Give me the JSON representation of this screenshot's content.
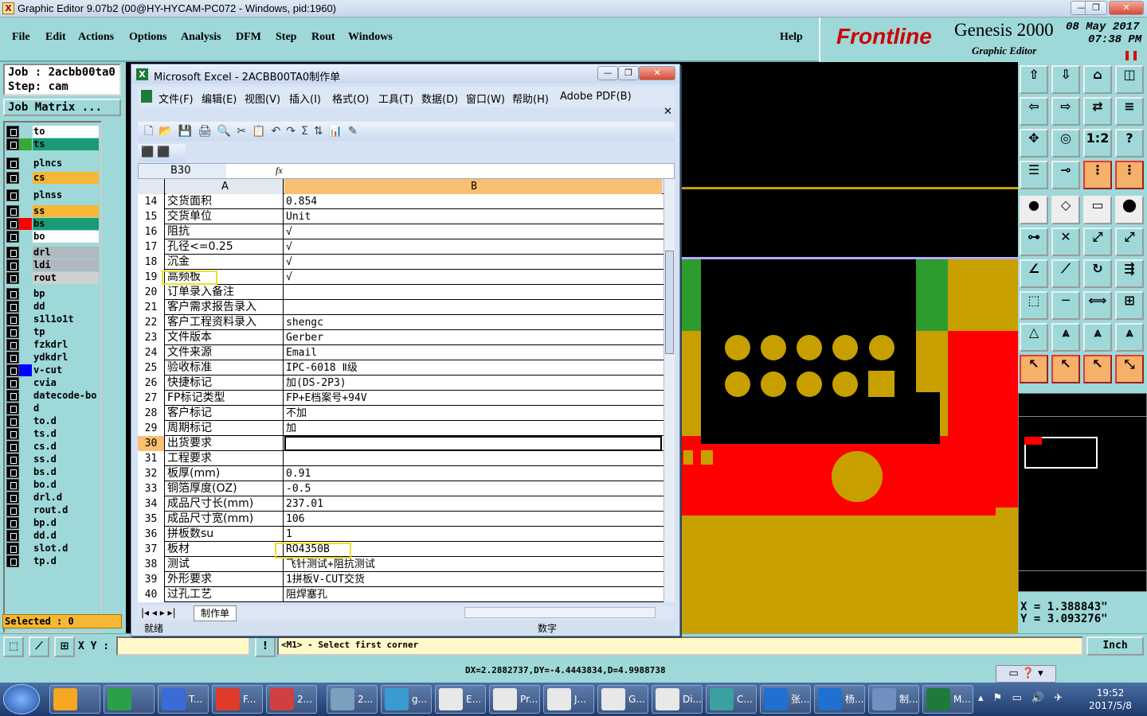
{
  "window": {
    "title": "Graphic Editor 9.07b2 (00@HY-HYCAM-PC072 - Windows, pid:1960)"
  },
  "menu": [
    "File",
    "Edit",
    "Actions",
    "Options",
    "Analysis",
    "DFM",
    "Step",
    "Rout",
    "Windows"
  ],
  "help": "Help",
  "brand": {
    "logo": "Frontline",
    "product": "Genesis 2000",
    "subtitle": "Graphic Editor",
    "date": "08 May 2017",
    "time": "07:38 PM"
  },
  "job": {
    "job_label": "Job : 2acbb00ta0",
    "step_label": "Step: cam",
    "matrix_button": "Job Matrix ..."
  },
  "layers": [
    {
      "name": "to",
      "color": "#ffffff",
      "swatch": ""
    },
    {
      "name": "ts",
      "color": "#1a9b76",
      "swatch": "#38a838"
    },
    {
      "name": "plncs",
      "color": "#9ed8d8",
      "swatch": ""
    },
    {
      "name": "cs",
      "color": "#f5b735",
      "swatch": ""
    },
    {
      "name": "plnss",
      "color": "#9ed8d8",
      "swatch": ""
    },
    {
      "name": "ss",
      "color": "#f5b735",
      "swatch": ""
    },
    {
      "name": "bs",
      "color": "#1a9b76",
      "swatch": "#ff0000"
    },
    {
      "name": "bo",
      "color": "#ffffff",
      "swatch": ""
    },
    {
      "name": "drl",
      "color": "#b0b8c0",
      "swatch": ""
    },
    {
      "name": "ldi",
      "color": "#b0b8c0",
      "swatch": ""
    },
    {
      "name": "rout",
      "color": "#d0d0d0",
      "swatch": ""
    },
    {
      "name": "bp",
      "color": "#9ed8d8",
      "swatch": ""
    },
    {
      "name": "dd",
      "color": "#9ed8d8",
      "swatch": ""
    },
    {
      "name": "s1l1o1t",
      "color": "#9ed8d8",
      "swatch": ""
    },
    {
      "name": "tp",
      "color": "#9ed8d8",
      "swatch": ""
    },
    {
      "name": "fzkdrl",
      "color": "#9ed8d8",
      "swatch": ""
    },
    {
      "name": "ydkdrl",
      "color": "#9ed8d8",
      "swatch": ""
    },
    {
      "name": "v-cut",
      "color": "#9ed8d8",
      "swatch": "#0000ff"
    },
    {
      "name": "cvia",
      "color": "#9ed8d8",
      "swatch": ""
    },
    {
      "name": "datecode-bo",
      "color": "#9ed8d8",
      "swatch": ""
    },
    {
      "name": "d",
      "color": "#9ed8d8",
      "swatch": ""
    },
    {
      "name": "to.d",
      "color": "#9ed8d8",
      "swatch": ""
    },
    {
      "name": "ts.d",
      "color": "#9ed8d8",
      "swatch": ""
    },
    {
      "name": "cs.d",
      "color": "#9ed8d8",
      "swatch": ""
    },
    {
      "name": "ss.d",
      "color": "#9ed8d8",
      "swatch": ""
    },
    {
      "name": "bs.d",
      "color": "#9ed8d8",
      "swatch": ""
    },
    {
      "name": "bo.d",
      "color": "#9ed8d8",
      "swatch": ""
    },
    {
      "name": "drl.d",
      "color": "#9ed8d8",
      "swatch": ""
    },
    {
      "name": "rout.d",
      "color": "#9ed8d8",
      "swatch": ""
    },
    {
      "name": "bp.d",
      "color": "#9ed8d8",
      "swatch": ""
    },
    {
      "name": "dd.d",
      "color": "#9ed8d8",
      "swatch": ""
    },
    {
      "name": "slot.d",
      "color": "#9ed8d8",
      "swatch": ""
    },
    {
      "name": "tp.d",
      "color": "#9ed8d8",
      "swatch": ""
    }
  ],
  "selected": "Selected : 0",
  "coords": {
    "x": "X = 1.388843\"",
    "y": "Y = 3.093276\""
  },
  "unit": "Inch",
  "xy_label": "X Y :",
  "prompt": "<M1> - Select first corner",
  "measure": "DX=2.2882737,DY=-4.4443834,D=4.9988738",
  "excel": {
    "title": "Microsoft Excel - 2ACBB00TA0制作单",
    "menu": [
      "文件(F)",
      "编辑(E)",
      "视图(V)",
      "插入(I)",
      "格式(O)",
      "工具(T)",
      "数据(D)",
      "窗口(W)",
      "帮助(H)",
      "Adobe PDF(B)"
    ],
    "namebox": "B30",
    "fx": "fx",
    "col_a": "A",
    "col_b": "B",
    "rows": [
      {
        "n": "14",
        "a": "交货面积",
        "b": "0.854"
      },
      {
        "n": "15",
        "a": "交货单位",
        "b": "Unit"
      },
      {
        "n": "16",
        "a": "阻抗",
        "b": "√"
      },
      {
        "n": "17",
        "a": "孔径<=0.25",
        "b": "√"
      },
      {
        "n": "18",
        "a": "沉金",
        "b": "√"
      },
      {
        "n": "19",
        "a": "高频板",
        "b": "√"
      },
      {
        "n": "20",
        "a": "订单录入备注",
        "b": ""
      },
      {
        "n": "21",
        "a": "客户需求报告录入",
        "b": ""
      },
      {
        "n": "22",
        "a": "客户工程资料录入",
        "b": "shengc"
      },
      {
        "n": "23",
        "a": "文件版本",
        "b": "Gerber"
      },
      {
        "n": "24",
        "a": "文件来源",
        "b": "Email"
      },
      {
        "n": "25",
        "a": "验收标准",
        "b": "IPC-6018 Ⅱ级"
      },
      {
        "n": "26",
        "a": "快捷标记",
        "b": "加(DS-2P3)"
      },
      {
        "n": "27",
        "a": "FP标记类型",
        "b": "FP+E档案号+94V"
      },
      {
        "n": "28",
        "a": "客户标记",
        "b": "不加"
      },
      {
        "n": "29",
        "a": "周期标记",
        "b": "加"
      },
      {
        "n": "30",
        "a": "出货要求",
        "b": ""
      },
      {
        "n": "31",
        "a": "工程要求",
        "b": ""
      },
      {
        "n": "32",
        "a": "板厚(mm)",
        "b": "0.91"
      },
      {
        "n": "33",
        "a": "铜箔厚度(OZ)",
        "b": "-0.5"
      },
      {
        "n": "34",
        "a": "成品尺寸长(mm)",
        "b": "237.01"
      },
      {
        "n": "35",
        "a": "成品尺寸宽(mm)",
        "b": "106"
      },
      {
        "n": "36",
        "a": "拼板数su",
        "b": "1"
      },
      {
        "n": "37",
        "a": "板材",
        "b": "RO4350B"
      },
      {
        "n": "38",
        "a": "测试",
        "b": "飞针测试+阻抗测试"
      },
      {
        "n": "39",
        "a": "外形要求",
        "b": "1拼板V-CUT交货"
      },
      {
        "n": "40",
        "a": "过孔工艺",
        "b": "阻焊塞孔"
      }
    ],
    "sheet_tab": "制作单",
    "status_ready": "就绪",
    "status_num": "数字"
  },
  "taskbar": {
    "items": [
      "",
      "",
      "T...",
      "F...",
      "2...",
      "2...",
      "g...",
      "E...",
      "Pr...",
      "J...",
      "G...",
      "Di...",
      "C...",
      "张...",
      "杨...",
      "制...",
      "M..."
    ],
    "time": "19:52",
    "date": "2017/5/8"
  }
}
